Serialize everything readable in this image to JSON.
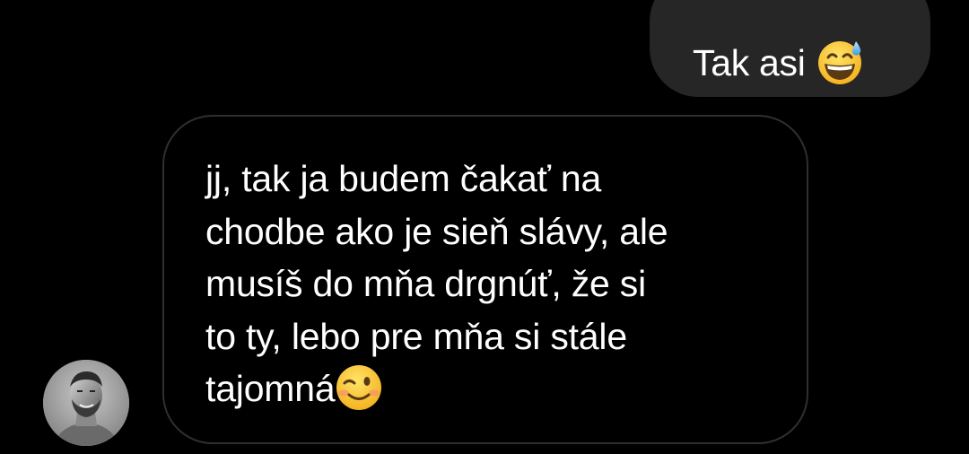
{
  "messages": [
    {
      "direction": "outgoing",
      "text": "Tak asi",
      "emoji": "grinning-face-with-sweat-emoji"
    },
    {
      "direction": "incoming",
      "text": "jj, tak ja budem čakať na\nchodbe ako je sieň slávy, ale\nmusíš do mňa drgnúť, že si\nto ty, lebo pre mňa si stále\ntajomná",
      "emoji": "winking-face-emoji"
    }
  ],
  "contact": {
    "avatar": "contact-avatar"
  },
  "colors": {
    "background": "#000000",
    "outgoing_bubble": "#262626",
    "incoming_border": "#2f2f2f",
    "text": "#ffffff"
  }
}
